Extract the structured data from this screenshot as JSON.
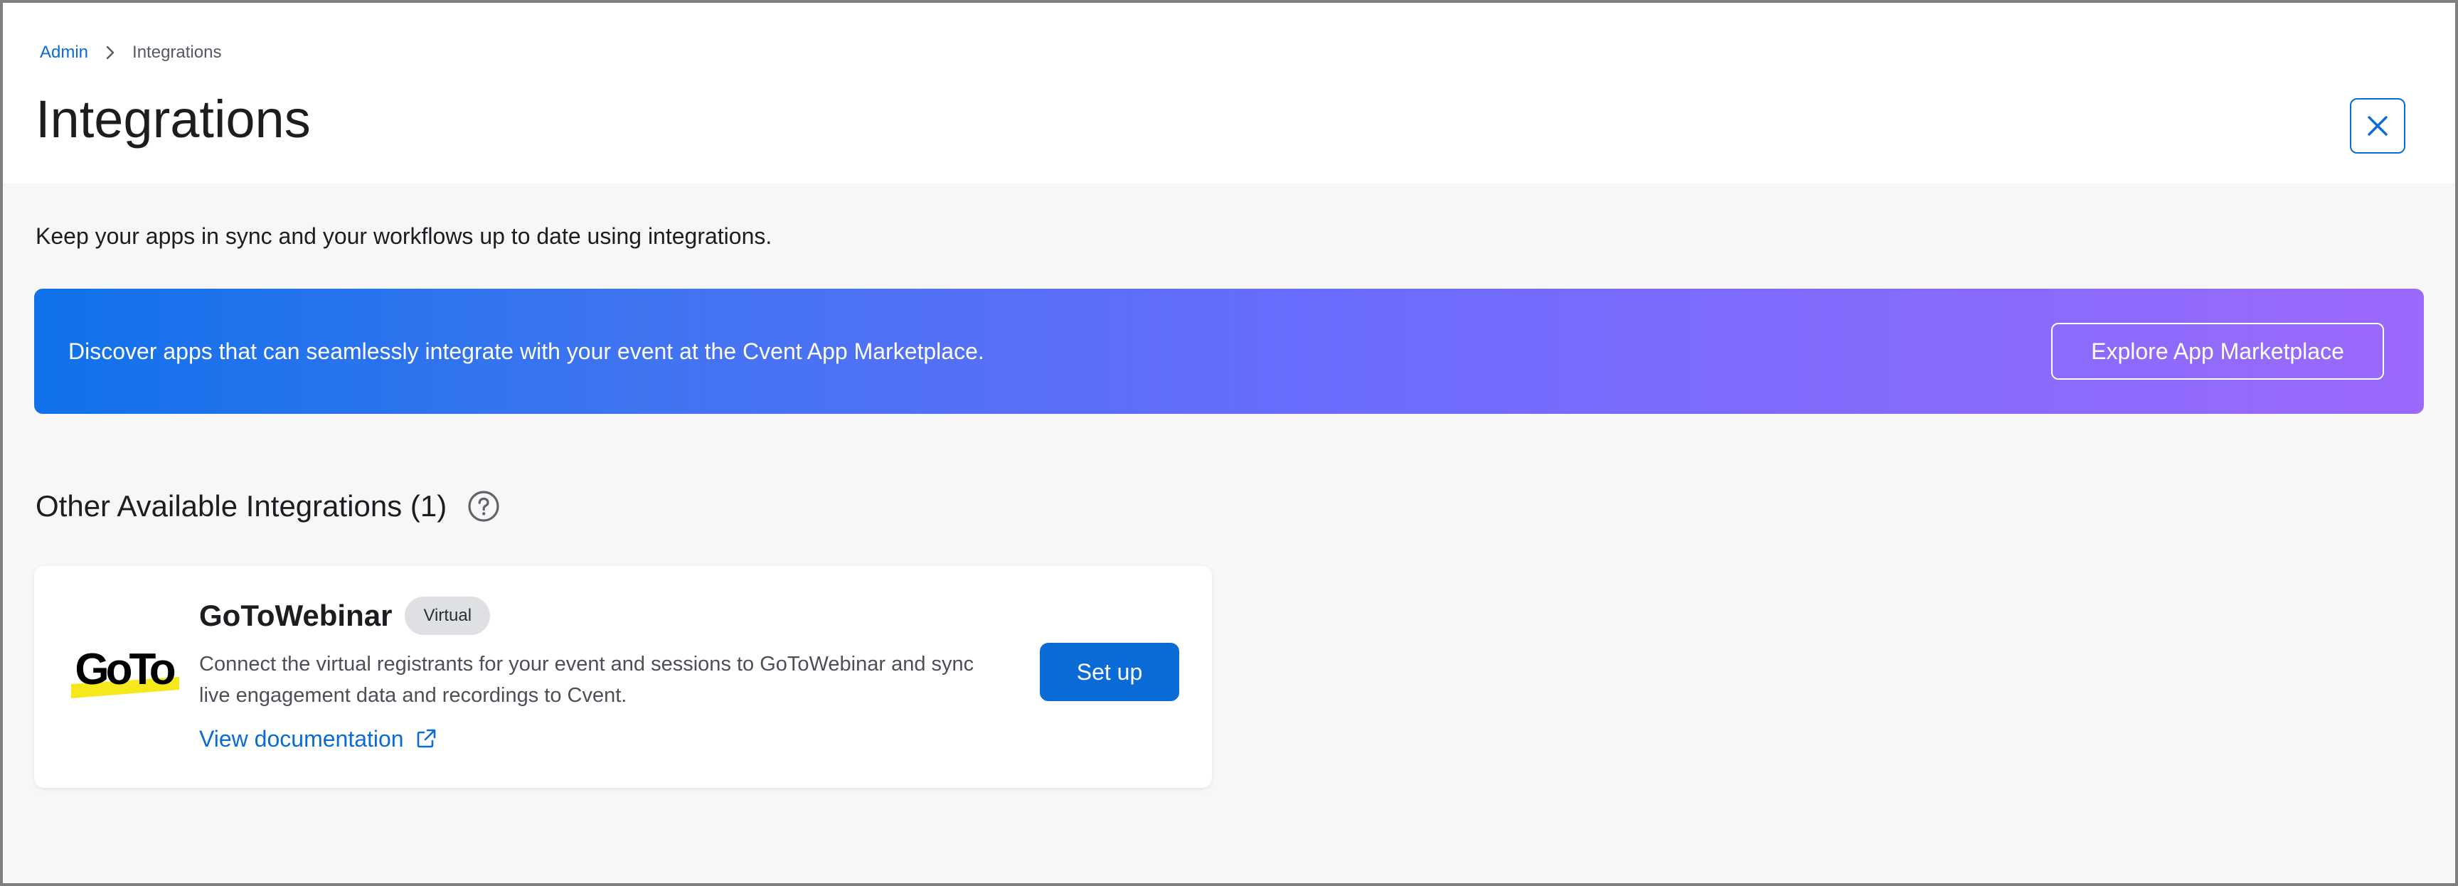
{
  "colors": {
    "accent": "#0a6bd6",
    "banner_start": "#0f72ea",
    "banner_end": "#9b69fb",
    "logo_highlight": "#f6e81a"
  },
  "breadcrumb": {
    "items": [
      {
        "label": "Admin"
      },
      {
        "label": "Integrations"
      }
    ],
    "separator_icon": "chevron-right-icon"
  },
  "header": {
    "title": "Integrations",
    "close_icon": "close-icon"
  },
  "intro": {
    "text": "Keep your apps in sync and your workflows up to date using integrations."
  },
  "banner": {
    "text": "Discover apps that can seamlessly integrate with your event at the Cvent App Marketplace.",
    "button_label": "Explore App Marketplace"
  },
  "section": {
    "title": "Other Available Integrations (1)",
    "help_icon": "help-circle-icon"
  },
  "integrations": [
    {
      "logo_text": "GoTo",
      "name": "GoToWebinar",
      "badge": "Virtual",
      "description_lines": [
        "Connect the virtual registrants for your event and sessions to GoToWebinar and sync",
        "live engagement data and recordings to Cvent."
      ],
      "doc_link_label": "View documentation",
      "doc_link_icon": "external-link-icon",
      "action_label": "Set up"
    }
  ]
}
